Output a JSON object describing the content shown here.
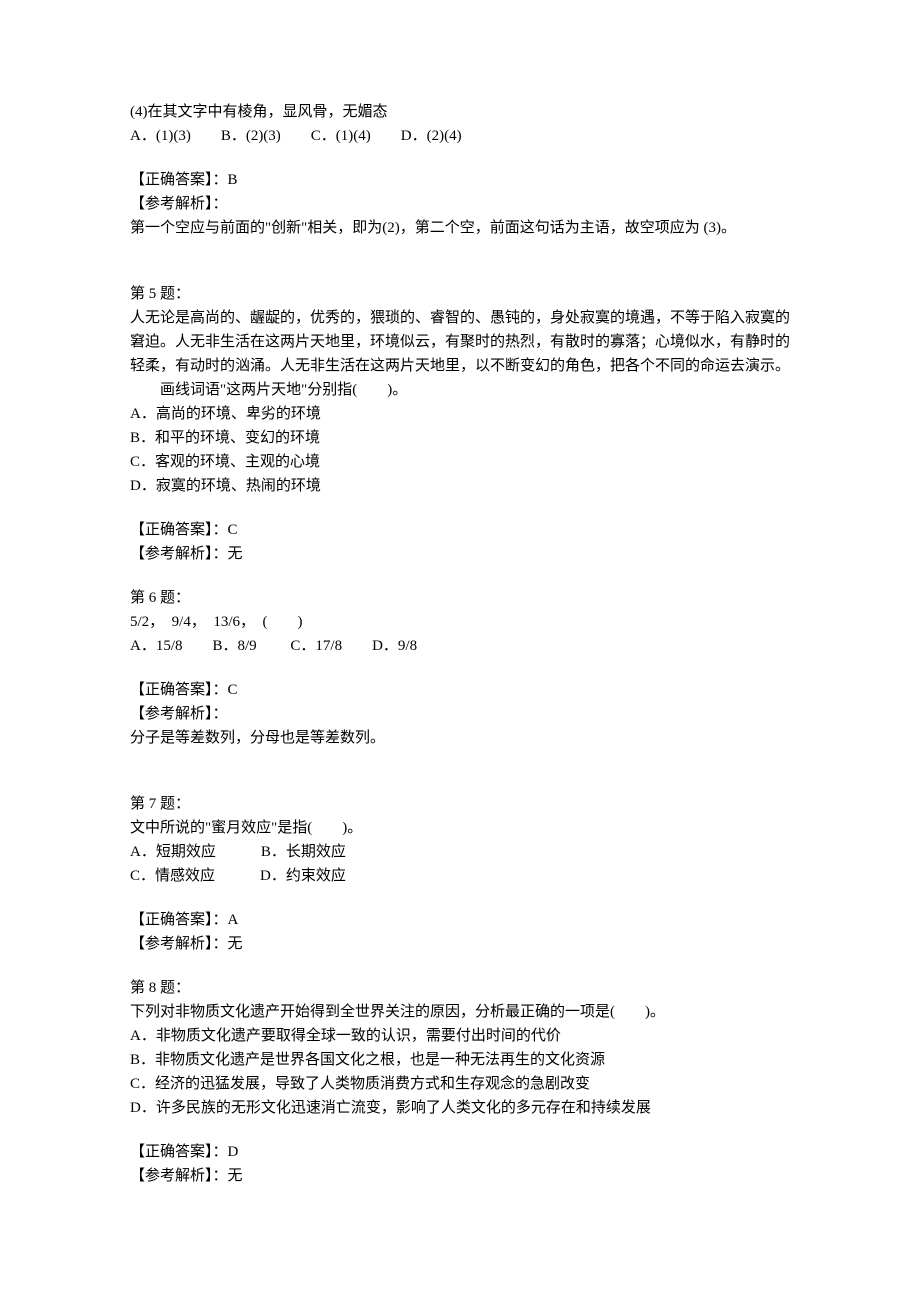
{
  "q4": {
    "stem_line": "(4)在其文字中有棱角，显风骨，无媚态",
    "options": "A．(1)(3)　　B．(2)(3)　　C．(1)(4)　　D．(2)(4)",
    "answer_label": "【正确答案】：B",
    "explain_label": "【参考解析】：",
    "explain_text": "第一个空应与前面的\"创新\"相关，即为(2)，第二个空，前面这句话为主语，故空项应为 (3)。"
  },
  "q5": {
    "title": "第 5 题：",
    "p1": "人无论是高尚的、龌龊的，优秀的，猥琐的、睿智的、愚钝的，身处寂寞的境遇，不等于陷入寂寞的窘迫。人无非生活在这两片天地里，环境似云，有聚时的热烈，有散时的寡落；心境似水，有静时的轻柔，有动时的汹涌。人无非生活在这两片天地里，以不断变幻的角色，把各个不同的命运去演示。",
    "p2": "　　画线词语\"这两片天地\"分别指(　　)。",
    "optA": "A．高尚的环境、卑劣的环境",
    "optB": "B．和平的环境、变幻的环境",
    "optC": "C．客观的环境、主观的心境",
    "optD": "D．寂寞的环境、热闹的环境",
    "answer_label": "【正确答案】：C",
    "explain_label": "【参考解析】：无"
  },
  "q6": {
    "title": "第 6 题：",
    "stem": "5/2，　9/4，　13/6，　(　　)",
    "options": "A．15/8　　B．8/9　　 C．17/8　　D．9/8",
    "answer_label": "【正确答案】：C",
    "explain_label": "【参考解析】：",
    "explain_text": "分子是等差数列，分母也是等差数列。"
  },
  "q7": {
    "title": "第 7 题：",
    "stem": "文中所说的\"蜜月效应\"是指(　　)。",
    "line1": "A．短期效应　　　B．长期效应",
    "line2": "C．情感效应　　　D．约束效应",
    "answer_label": "【正确答案】：A",
    "explain_label": "【参考解析】：无"
  },
  "q8": {
    "title": "第 8 题：",
    "stem": "下列对非物质文化遗产开始得到全世界关注的原因，分析最正确的一项是(　　)。",
    "optA": "A．非物质文化遗产要取得全球一致的认识，需要付出时间的代价",
    "optB": "B．非物质文化遗产是世界各国文化之根，也是一种无法再生的文化资源",
    "optC": "C．经济的迅猛发展，导致了人类物质消费方式和生存观念的急剧改变",
    "optD": "D．许多民族的无形文化迅速消亡流变，影响了人类文化的多元存在和持续发展",
    "answer_label": "【正确答案】：D",
    "explain_label": "【参考解析】：无"
  }
}
